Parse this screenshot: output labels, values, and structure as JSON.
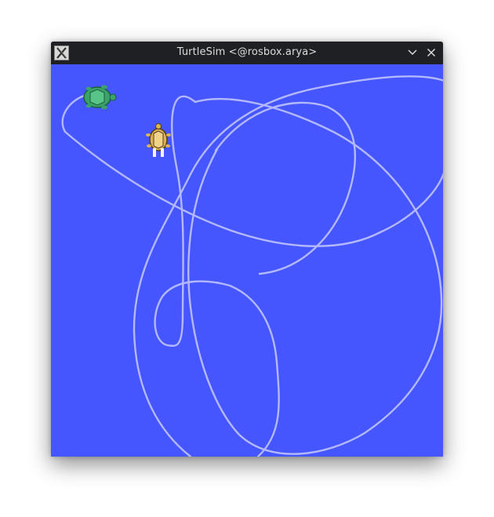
{
  "window": {
    "title": "TurtleSim <@rosbox.arya>",
    "app_icon": "x11-icon",
    "buttons": [
      {
        "name": "minimize",
        "icon": "chevron-down-icon"
      },
      {
        "name": "close",
        "icon": "close-icon"
      }
    ]
  },
  "canvas": {
    "background_color": "#4556ff",
    "pen_color": "#b3b8ff",
    "turtles": [
      {
        "name": "turtle-green",
        "icon": "turtle-icon",
        "color": "#3aa26a"
      },
      {
        "name": "turtle-yellow",
        "icon": "turtle-icon",
        "color": "#d9b35a"
      }
    ]
  }
}
